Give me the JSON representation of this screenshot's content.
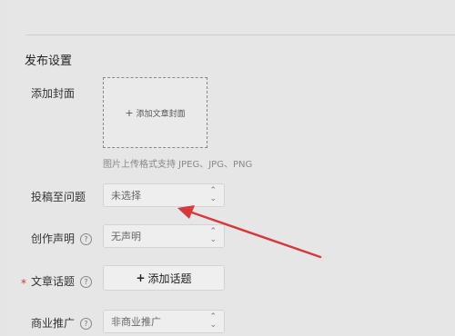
{
  "section": {
    "title": "发布设置"
  },
  "cover": {
    "label": "添加封面",
    "button_plus": "+",
    "button_label": "添加文章封面",
    "hint": "图片上传格式支持 JPEG、JPG、PNG"
  },
  "question": {
    "label": "投稿至问题",
    "value": "未选择"
  },
  "declaration": {
    "label": "创作声明",
    "help": "?",
    "value": "无声明"
  },
  "topic": {
    "required_mark": "*",
    "label": "文章话题",
    "help": "?",
    "button_plus": "+",
    "button_label": "添加话题"
  },
  "promotion": {
    "label": "商业推广",
    "help": "?",
    "value": "非商业推广"
  },
  "icons": {
    "select_caret": "updown-caret-icon",
    "help": "question-circle-icon"
  },
  "colors": {
    "annotation_arrow": "#d9383a",
    "required": "#dd3333"
  }
}
